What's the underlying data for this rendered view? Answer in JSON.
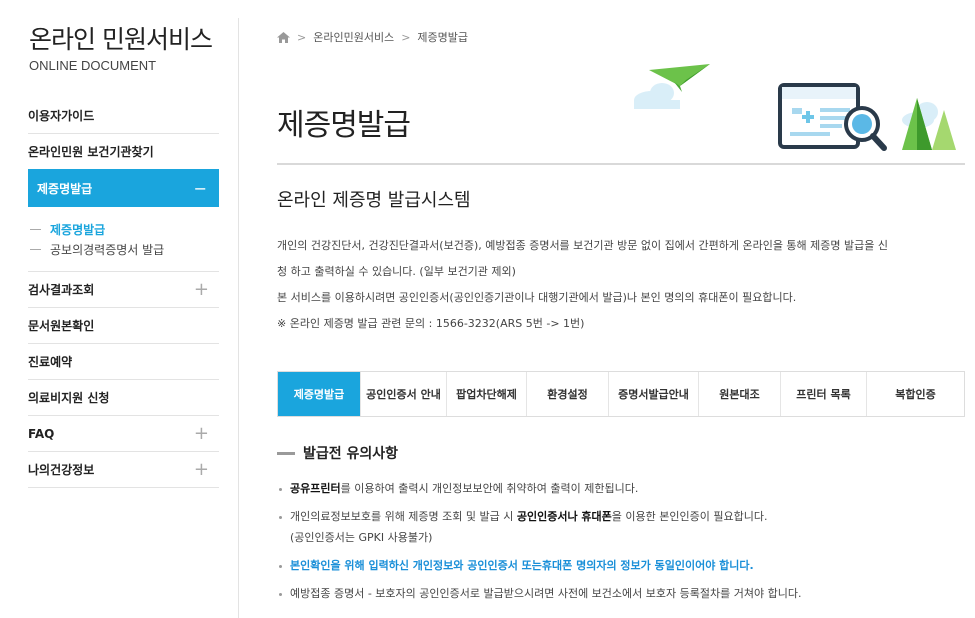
{
  "sidebar": {
    "title": "온라인 민원서비스",
    "subtitle": "ONLINE DOCUMENT",
    "items": [
      {
        "label": "이용자가이드"
      },
      {
        "label": "온라인민원 보건기관찾기"
      },
      {
        "label": "제증명발급",
        "toggle": "−"
      },
      {
        "label": "검사결과조회",
        "toggle": "+"
      },
      {
        "label": "문서원본확인"
      },
      {
        "label": "진료예약"
      },
      {
        "label": "의료비지원 신청"
      },
      {
        "label": "FAQ",
        "toggle": "+"
      },
      {
        "label": "나의건강정보",
        "toggle": "+"
      }
    ],
    "subitems": [
      {
        "label": "제증명발급"
      },
      {
        "label": "공보의경력증명서 발급"
      }
    ]
  },
  "breadcrumb": {
    "home_icon": "home-icon",
    "sep": ">",
    "items": [
      "온라인민원서비스",
      "제증명발급"
    ]
  },
  "page": {
    "title": "제증명발급",
    "section_title": "온라인 제증명 발급시스템",
    "desc": [
      "개인의 건강진단서, 건강진단결과서(보건증), 예방접종 증명서를 보건기관 방문 없이 집에서 간편하게 온라인을 통해 제증명 발급을 신",
      "청 하고 출력하실 수 있습니다. (일부 보건기관 제외)",
      "본 서비스를 이용하시려면 공인인증서(공인인증기관이나 대행기관에서 발급)나 본인 명의의 휴대폰이 필요합니다.",
      "※ 온라인 제증명 발급 관련 문의 : 1566-3232(ARS 5번 -> 1번)"
    ]
  },
  "tabs": [
    {
      "label": "제증명발급"
    },
    {
      "label": "공인인증서 안내"
    },
    {
      "label": "팝업차단해제"
    },
    {
      "label": "환경설정"
    },
    {
      "label": "증명서발급안내"
    },
    {
      "label": "원본대조"
    },
    {
      "label": "프린터 목록"
    },
    {
      "label": "복합인증"
    }
  ],
  "notice": {
    "title": "발급전 유의사항",
    "items": [
      {
        "b1": "공유프린터",
        "t1": "를 이용하여 출력시 개인정보보안에 취약하여 출력이 제한됩니다."
      },
      {
        "t1": "개인의료정보보호를 위해 제증명 조회 및 발급 시 ",
        "b1": "공인인증서나 휴대폰",
        "t2": "을 이용한 본인인증이 필요합니다.",
        "line2": "(공인인증서는 GPKI 사용불가)"
      },
      {
        "t1": "본인확인을 위해 입력하신 개인정보와 공인인증서 또는휴대폰 명의자의 정보가 동일인이어야 합니다."
      },
      {
        "t1": "예방접종 증명서 - 보호자의 공인인증서로 발급받으시려면 사전에 보건소에서 보호자 등록절차를 거쳐야 합니다."
      }
    ]
  },
  "colors": {
    "accent": "#1aa5dd",
    "highlight_text": "#1a8fd8"
  }
}
